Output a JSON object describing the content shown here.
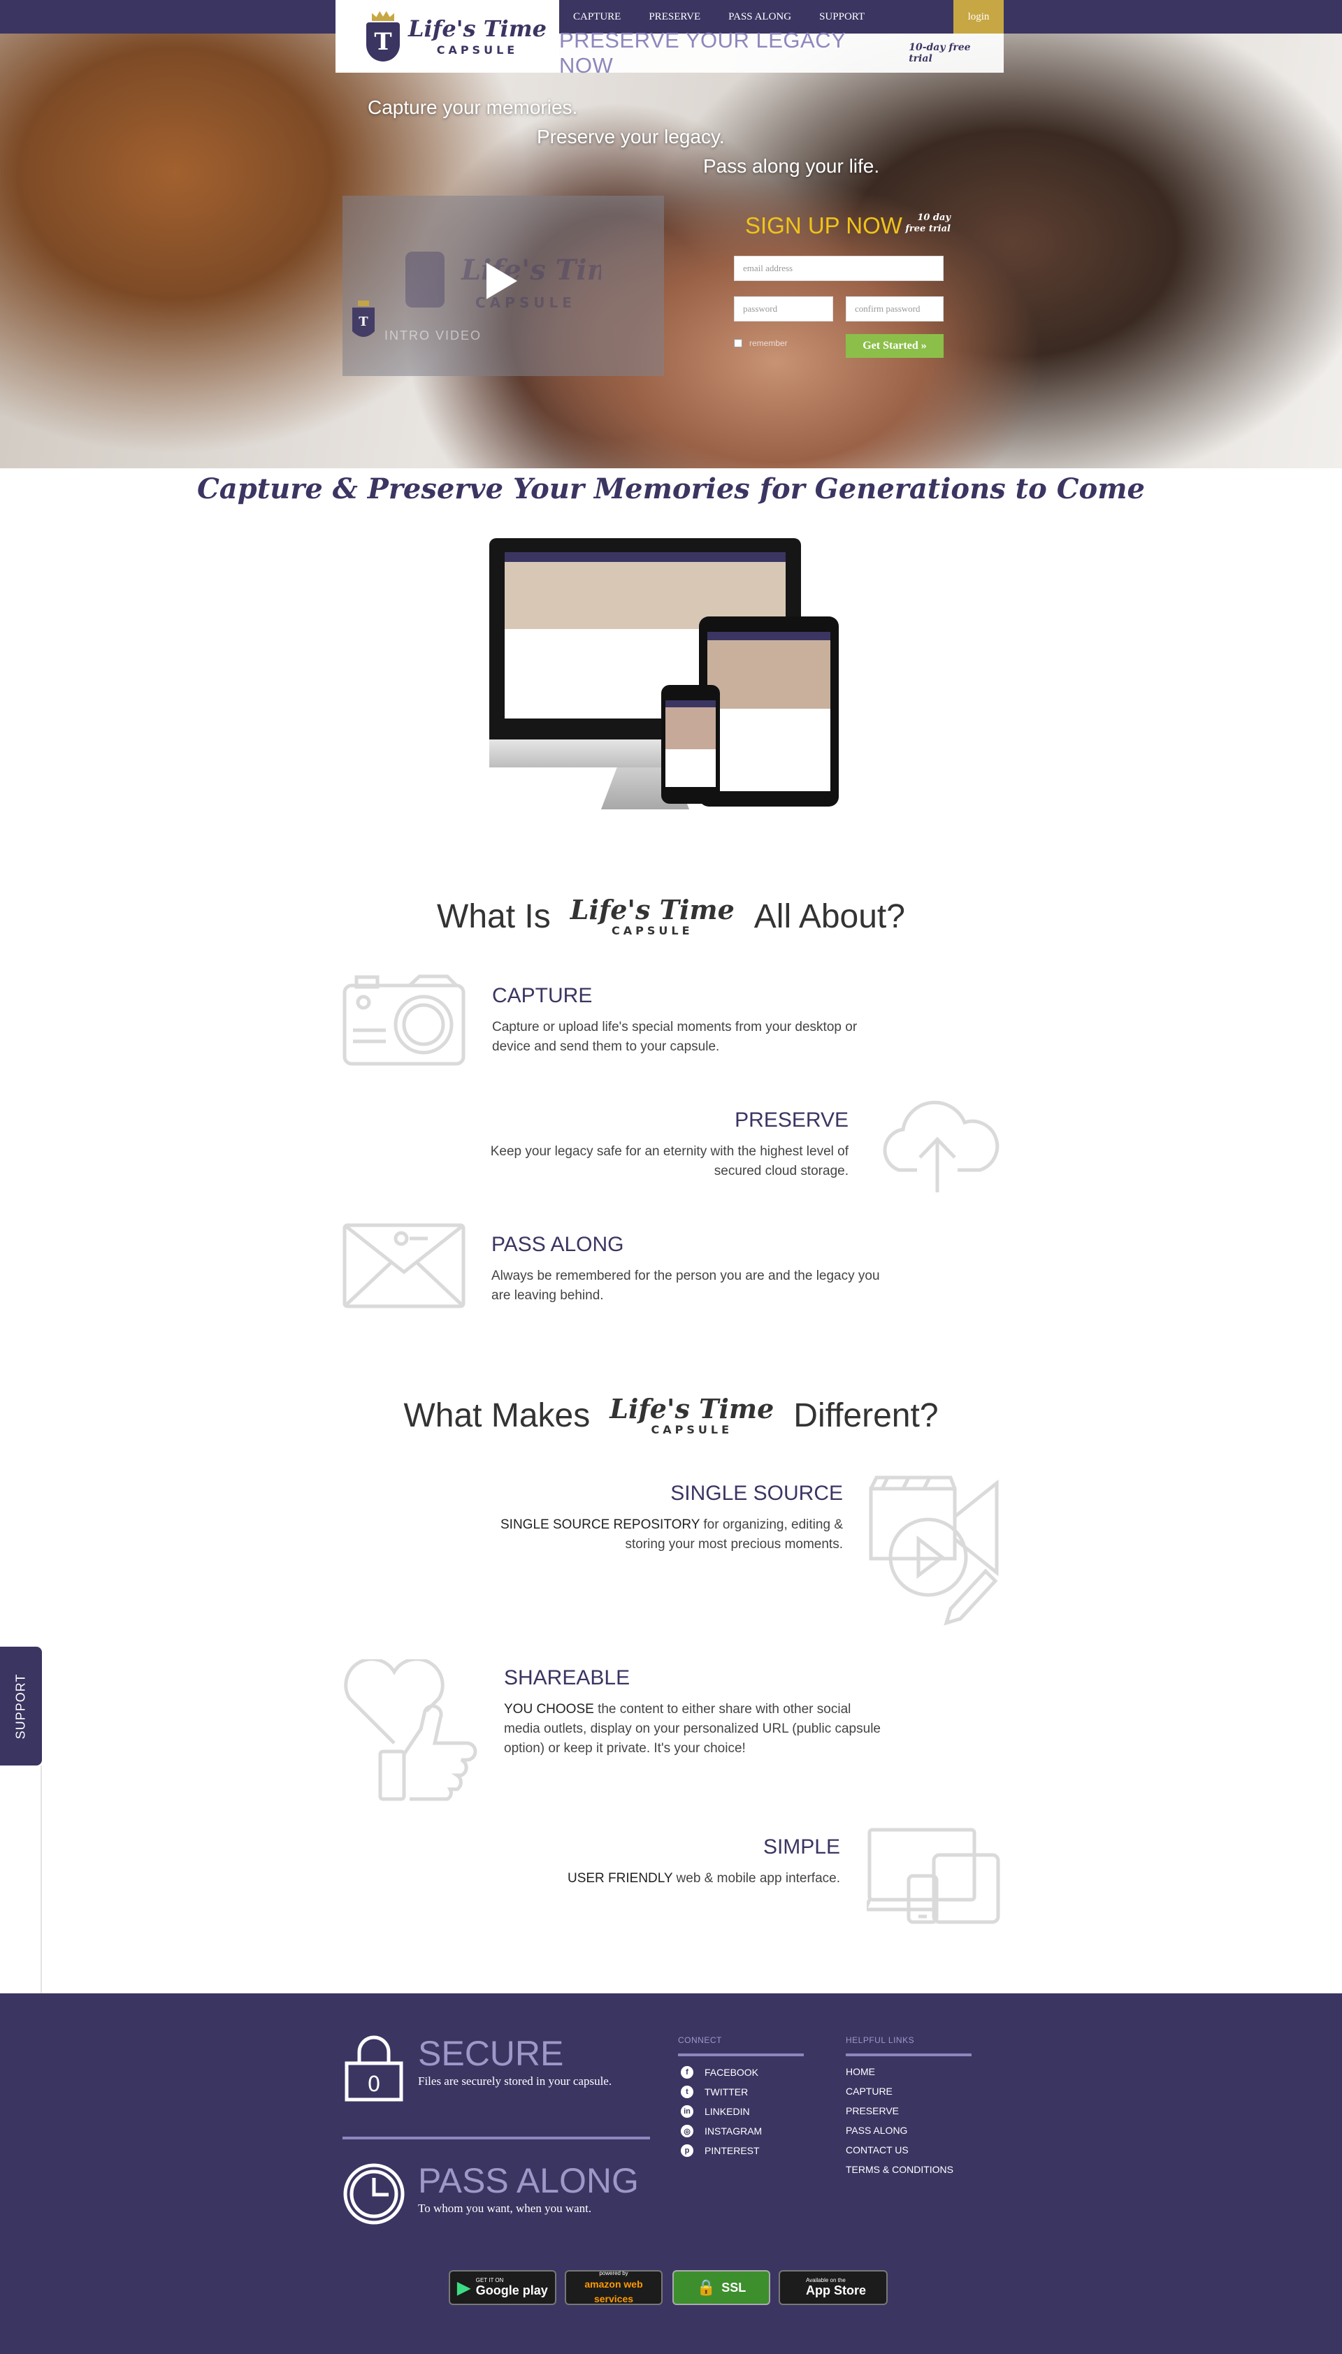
{
  "brand": {
    "script": "Life's Time",
    "caps": "CAPSULE",
    "mark": "T"
  },
  "nav": {
    "items": [
      "CAPTURE",
      "PRESERVE",
      "PASS ALONG",
      "SUPPORT"
    ],
    "login": "login"
  },
  "legacy_bar": {
    "title": "PRESERVE YOUR LEGACY NOW",
    "trial": "10-day free trial"
  },
  "hero": {
    "taglines": [
      "Capture your memories.",
      "Preserve your legacy.",
      "Pass along your life."
    ],
    "video_caption": "INTRO VIDEO"
  },
  "signup": {
    "title": "SIGN UP NOW",
    "trial_line1": "10 day",
    "trial_line2": "free trial",
    "email_placeholder": "email address",
    "password_placeholder": "password",
    "confirm_placeholder": "confirm password",
    "remember": "remember",
    "button": "Get Started »"
  },
  "headline": "Capture & Preserve Your Memories for Generations to Come",
  "about": {
    "head_before": "What Is",
    "head_after": "All About?",
    "features": [
      {
        "title": "CAPTURE",
        "text": "Capture or upload life's special moments from your desktop or device and send them to your capsule.",
        "icon": "camera-icon"
      },
      {
        "title": "PRESERVE",
        "text": "Keep your legacy safe for an eternity with the highest level of secured cloud storage.",
        "icon": "cloud-upload-icon"
      },
      {
        "title": "PASS ALONG",
        "text": "Always be remembered for the person you are and the legacy you are leaving behind.",
        "icon": "envelope-icon"
      }
    ]
  },
  "different": {
    "head_before": "What Makes",
    "head_after": "Different?",
    "features": [
      {
        "title": "SINGLE SOURCE",
        "lead": "SINGLE SOURCE REPOSITORY",
        "text": " for organizing, editing & storing your most precious moments.",
        "icon": "media-edit-icon"
      },
      {
        "title": "SHAREABLE",
        "lead": "YOU CHOOSE",
        "text": " the content to either share with other social media outlets, display on your personalized URL (public capsule option) or keep it private. It's your choice!",
        "icon": "heart-thumbs-up-icon"
      },
      {
        "title": "SIMPLE",
        "lead": "USER FRIENDLY",
        "text": " web & mobile app interface.",
        "icon": "devices-icon"
      }
    ]
  },
  "support_tab": "SUPPORT",
  "footer": {
    "secure": {
      "title": "SECURE",
      "text": "Files are securely stored in your capsule.",
      "lock_digit": "0"
    },
    "pass": {
      "title": "PASS ALONG",
      "text": "To whom you want, when you want."
    },
    "connect": {
      "title": "CONNECT",
      "links": [
        {
          "label": "FACEBOOK",
          "glyph": "f"
        },
        {
          "label": "TWITTER",
          "glyph": "t"
        },
        {
          "label": "LINKEDIN",
          "glyph": "in"
        },
        {
          "label": "INSTAGRAM",
          "glyph": "◎"
        },
        {
          "label": "PINTEREST",
          "glyph": "p"
        }
      ]
    },
    "helpful": {
      "title": "HELPFUL LINKS",
      "links": [
        "HOME",
        "CAPTURE",
        "PRESERVE",
        "PASS ALONG",
        "CONTACT US",
        "TERMS & CONDITIONS"
      ]
    },
    "badges": [
      {
        "top": "GET IT ON",
        "main": "Google play"
      },
      {
        "top": "powered by",
        "main": "amazon web services"
      },
      {
        "top": "",
        "main": "SSL"
      },
      {
        "top": "Available on the",
        "main": "App Store"
      }
    ]
  },
  "colors": {
    "brand_purple": "#3b3562",
    "accent_gold": "#c7a743",
    "signup_yellow": "#f0c419",
    "button_green": "#8cbf4a",
    "light_purple": "#8d87bd"
  }
}
